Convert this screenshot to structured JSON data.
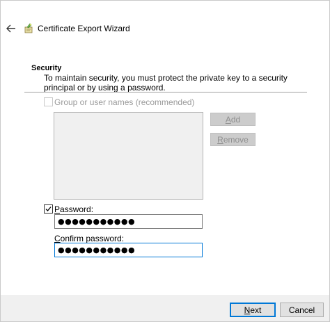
{
  "wizard": {
    "title": "Certificate Export Wizard"
  },
  "security": {
    "title": "Security",
    "description": "To maintain security, you must protect the private key to a security principal or by using a password."
  },
  "group_checkbox": {
    "label": "Group or user names (recommended)",
    "checked": false,
    "enabled": false
  },
  "buttons": {
    "add_first": "A",
    "add_rest": "dd",
    "remove_first": "R",
    "remove_rest": "emove",
    "next_first": "N",
    "next_rest": "ext",
    "cancel": "Cancel"
  },
  "password_checkbox": {
    "label_first": "P",
    "label_rest": "assword:",
    "checked": true
  },
  "password": {
    "value": "●●●●●●●●●●●"
  },
  "confirm_password": {
    "label_first": "C",
    "label_rest": "onfirm password:",
    "value": "●●●●●●●●●●●"
  },
  "icons": {
    "back": "back-arrow-icon",
    "wizard": "certificate-icon"
  },
  "colors": {
    "accent": "#0078d7",
    "disabled_button": "#cccccc",
    "listbox_bg": "#f0f0f0"
  }
}
